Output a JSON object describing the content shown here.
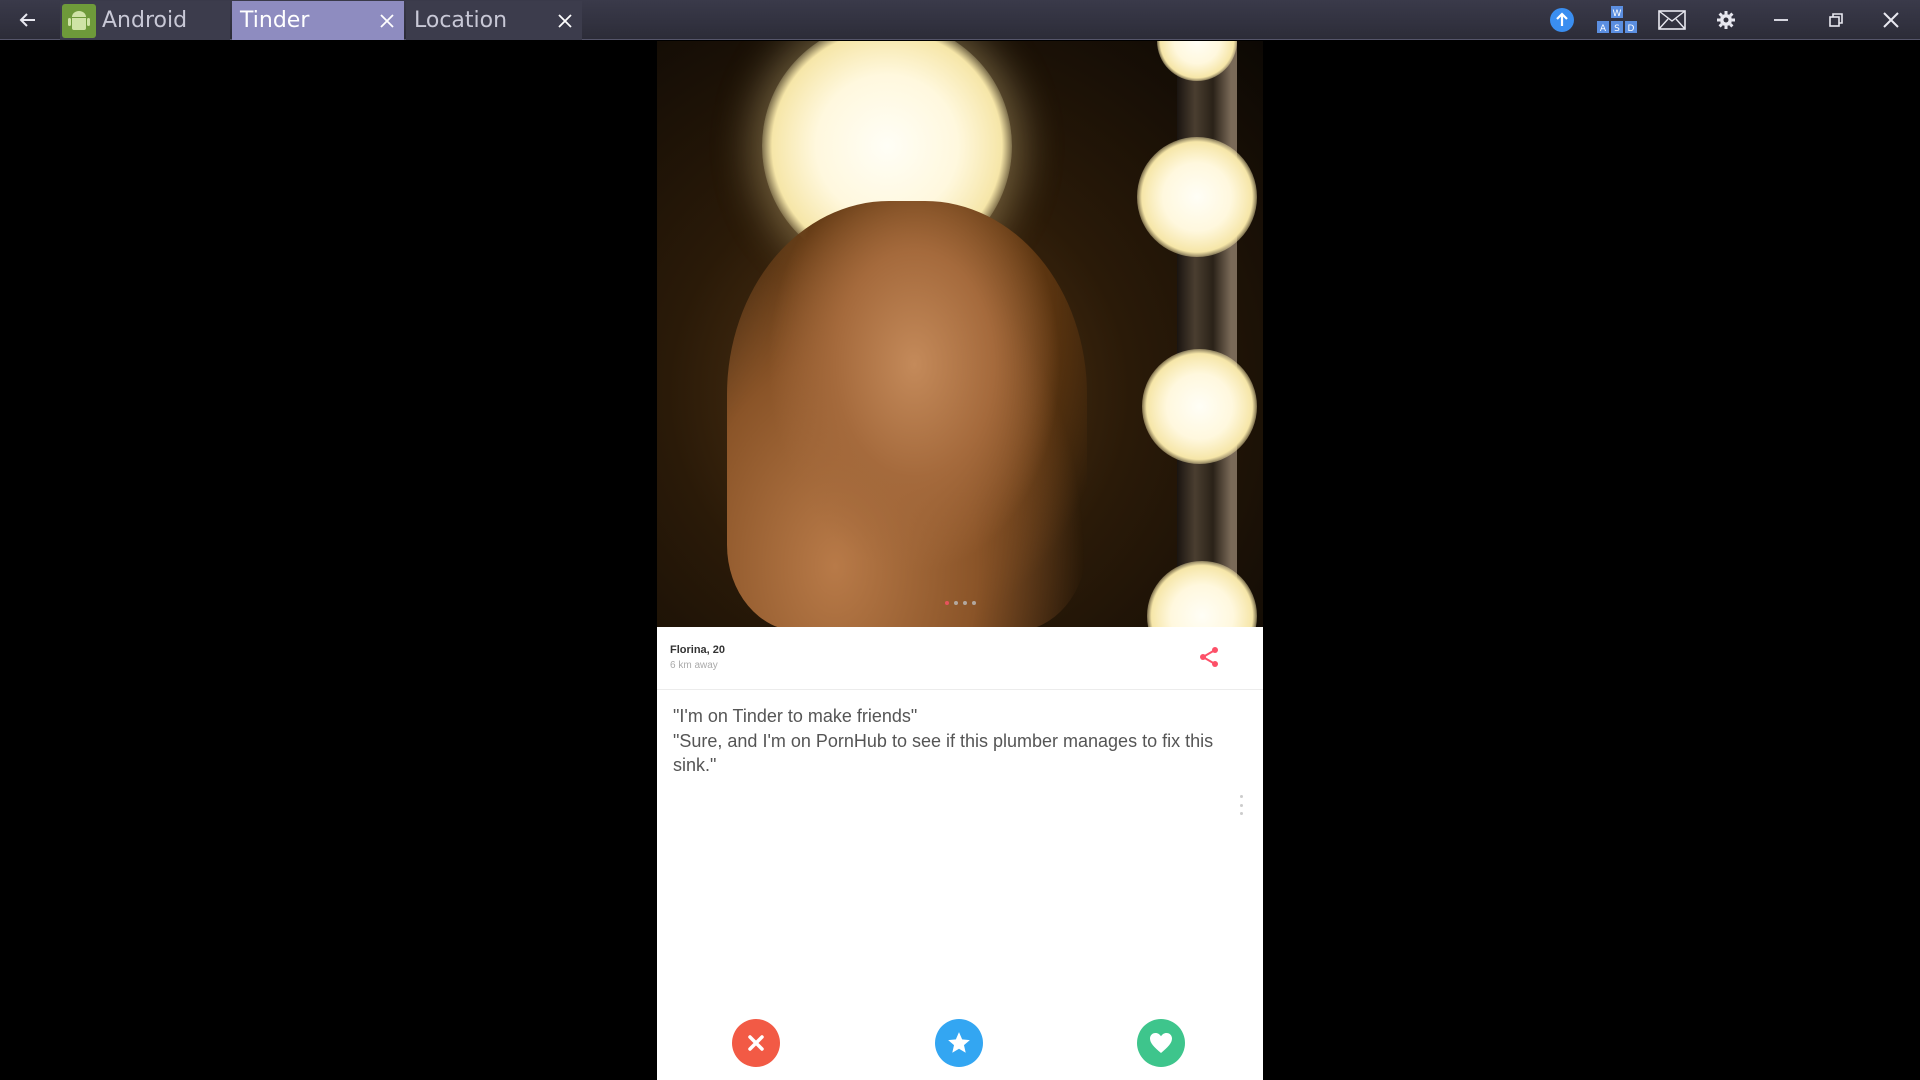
{
  "tabs": [
    {
      "label": "Android",
      "icon": "android-icon"
    },
    {
      "label": "Tinder",
      "active": true
    },
    {
      "label": "Location"
    }
  ],
  "toolbar": {
    "icons": [
      "back-arrow-icon",
      "upload-icon",
      "keyboard-wasd-icon",
      "mail-icon",
      "gear-icon",
      "minimize-icon",
      "restore-icon",
      "close-icon"
    ],
    "keys": {
      "w": "W",
      "a": "A",
      "s": "S",
      "d": "D"
    }
  },
  "profile": {
    "name": "Florina, 20",
    "distance": "6 km away",
    "photo_count": 4,
    "active_photo": 1,
    "bio_lines": [
      "\"I'm on Tinder to make friends\"",
      "\"Sure, and I'm on PornHub to see if this plumber manages to fix this sink.\""
    ]
  },
  "actions": [
    {
      "name": "nope",
      "icon": "x-icon",
      "color": "#f25a45"
    },
    {
      "name": "super-like",
      "icon": "star-icon",
      "color": "#33a6f2"
    },
    {
      "name": "like",
      "icon": "heart-icon",
      "color": "#3ec58c"
    }
  ],
  "colors": {
    "accent": "#fd5068",
    "active_tab": "#8e8cc0",
    "titlebar": "#2c2c38"
  }
}
